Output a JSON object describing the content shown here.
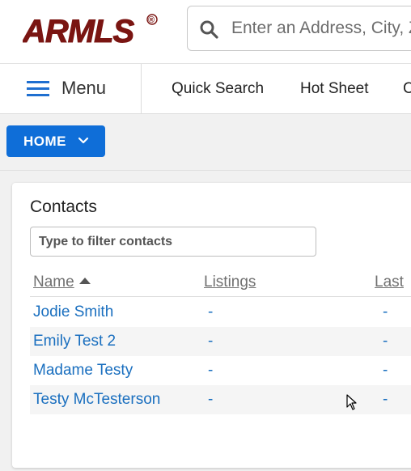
{
  "brand": {
    "logo_text": "ARMLS",
    "logo_mark": "®",
    "color": "#7a1512"
  },
  "search": {
    "placeholder": "Enter an Address, City, Zip, or MLS #",
    "icon": "search-icon"
  },
  "nav": {
    "menu_label": "Menu",
    "links": [
      "Quick Search",
      "Hot Sheet",
      "C"
    ]
  },
  "home_button": {
    "label": "HOME",
    "color": "#0f6ed8"
  },
  "contacts": {
    "title": "Contacts",
    "filter_placeholder": "Type to filter contacts",
    "columns": [
      "Name",
      "Listings",
      "Last"
    ],
    "sort_column": "Name",
    "rows": [
      {
        "name": "Jodie Smith",
        "listings": "-",
        "last": "-"
      },
      {
        "name": "Emily Test 2",
        "listings": "-",
        "last": "-"
      },
      {
        "name": "Madame Testy",
        "listings": "-",
        "last": "-"
      },
      {
        "name": "Testy McTesterson",
        "listings": "-",
        "last": "-"
      }
    ]
  },
  "colors": {
    "link": "#1a6fbf",
    "accent": "#0f6ed8"
  }
}
